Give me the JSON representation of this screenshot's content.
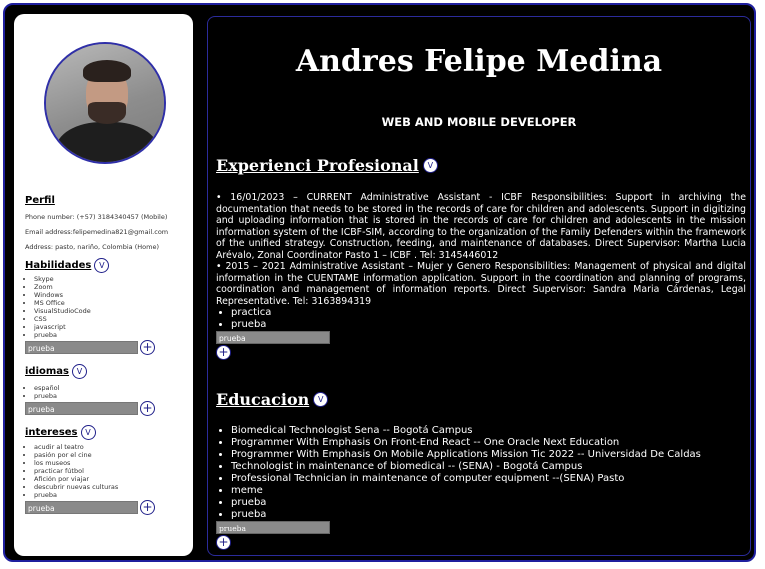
{
  "sidebar": {
    "perfil_title": "Perfil",
    "phone": "Phone number: (+57) 3184340457 (Mobile)",
    "email": "Email address:felipemedina821@gmail.com",
    "address": "Address: pasto, nariño, Colombia (Home)",
    "habilidades_title": "Habilidades",
    "habilidades": [
      "Skype",
      "Zoom",
      "Windows",
      "MS Office",
      "VisualStudioCode",
      "CSS",
      "javascript",
      "prueba"
    ],
    "habilidades_input": "prueba",
    "idiomas_title": "idiomas",
    "idiomas": [
      "español",
      "prueba"
    ],
    "idiomas_input": "prueba",
    "intereses_title": "intereses",
    "intereses": [
      "acudir al teatro",
      "pasión por el cine",
      "los museos",
      "practicar fútbol",
      "Afición por viajar",
      "descubrir nuevas culturas",
      "prueba"
    ],
    "intereses_input": "prueba",
    "toggle_label": "V",
    "add_label": "+"
  },
  "main": {
    "name": "Andres Felipe Medina",
    "role": "WEB AND MOBILE DEVELOPER",
    "experience_title": "Experienci Profesional",
    "experience_paragraphs": [
      "•  16/01/2023 – CURRENT Administrative Assistant - ICBF Responsibilities: Support in archiving the documentation that needs to be stored in the records of care for children and adolescents. Support in digitizing and uploading information that is stored in the records of care for children and adolescents in the mission information system of the ICBF-SIM, according to the organization of the Family Defenders within the framework of the unified strategy. Construction, feeding, and maintenance of databases. Direct Supervisor: Martha Lucia Arévalo, Zonal Coordinator Pasto 1 – ICBF . Tel: 3145446012",
      "•  2015 – 2021 Administrative Assistant – Mujer y Genero Responsibilities: Management of physical and digital information in the CUENTAME information application. Support in the coordination and planning of programs, coordination and management of information reports. Direct Supervisor: Sandra Maria Cárdenas, Legal Representative. Tel: 3163894319"
    ],
    "experience_items": [
      "practica",
      "prueba"
    ],
    "experience_input": "prueba",
    "education_title": "Educacion",
    "education_items": [
      "Biomedical Technologist Sena -- Bogotá Campus",
      "Programmer With Emphasis On Front-End React -- One Oracle Next Education",
      "Programmer With Emphasis On Mobile Applications Mission Tic 2022 -- Universidad De Caldas",
      "Technologist in maintenance of biomedical -- (SENA) - Bogotá Campus",
      "Professional Technician in maintenance of computer equipment --(SENA) Pasto",
      "meme",
      "prueba",
      "prueba"
    ],
    "education_input": "prueba"
  },
  "colors": {
    "frame_border": "#1f1f9e",
    "background": "#000000",
    "sidebar": "#ffffff",
    "input_fill": "#8a8a8a"
  }
}
